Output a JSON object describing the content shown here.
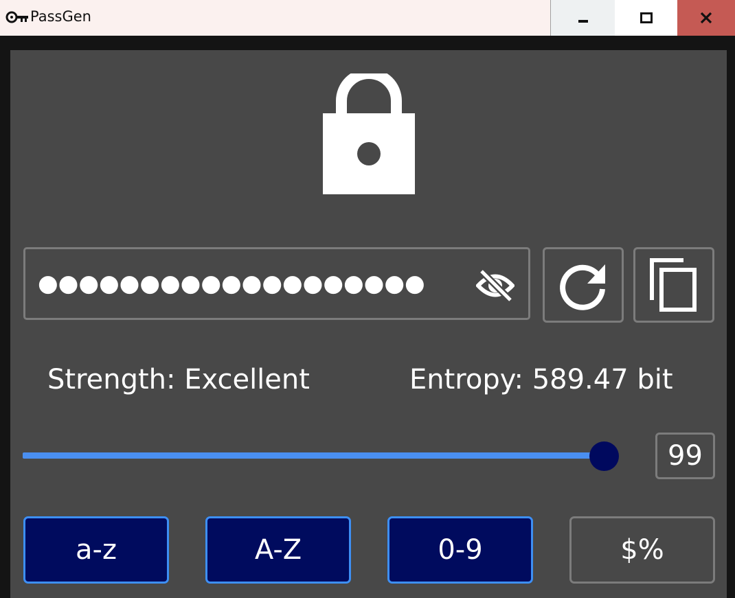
{
  "window": {
    "title": "PassGen",
    "controls": {
      "minimize": "minimize-icon",
      "maximize": "maximize-icon",
      "close": "close-icon"
    }
  },
  "header_icon": "lock-icon",
  "password": {
    "masked_value": "●●●●●●●●●●●●●●●●●●●",
    "visibility_icon": "eye-off-icon"
  },
  "actions": {
    "regenerate_icon": "refresh-icon",
    "copy_icon": "copy-icon"
  },
  "stats": {
    "strength": "Strength: Excellent",
    "entropy": "Entropy: 589.47 bit"
  },
  "length": {
    "value": "99",
    "slider_fraction": 1.0
  },
  "charsets": [
    {
      "label": "a-z",
      "enabled": true
    },
    {
      "label": "A-Z",
      "enabled": true
    },
    {
      "label": "0-9",
      "enabled": true
    },
    {
      "label": "$%",
      "enabled": false
    }
  ],
  "colors": {
    "accent": "#4a8ff0",
    "enabled_fill": "#000b5e",
    "panel": "#484848",
    "close_button": "#c55a54"
  }
}
